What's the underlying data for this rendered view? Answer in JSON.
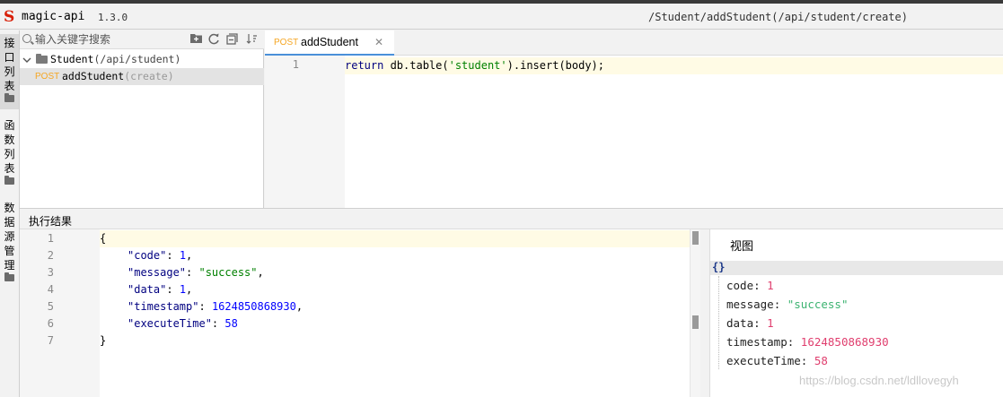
{
  "app": {
    "title": "magic-api",
    "version": "1.3.0",
    "current_path": "/Student/addStudent(/api/student/create)"
  },
  "left_tabs": [
    {
      "label": "接\n口\n列\n表"
    },
    {
      "label": "函\n数\n列\n表"
    },
    {
      "label": "数\n据\n源\n管\n理"
    }
  ],
  "tree": {
    "search_placeholder": "输入关键字搜索",
    "toolbar_icons": [
      "folder-add-icon",
      "refresh-icon",
      "collapse-icon",
      "sort-icon"
    ],
    "group": {
      "name": "Student",
      "path": "(/api/student)"
    },
    "api": {
      "method": "POST",
      "name": "addStudent",
      "path": "(create)"
    }
  },
  "editor": {
    "tab": {
      "method": "POST",
      "name": "addStudent"
    },
    "line_number": "1",
    "code": {
      "keyword": "return",
      "pre": " db.table(",
      "string": "'student'",
      "post": ").insert(body);"
    }
  },
  "result": {
    "title": "执行结果",
    "line_numbers": [
      "1",
      "2",
      "3",
      "4",
      "5",
      "6",
      "7"
    ],
    "json": {
      "open": "{",
      "code_key": "\"code\"",
      "code_val": "1",
      "message_key": "\"message\"",
      "message_val": "\"success\"",
      "data_key": "\"data\"",
      "data_val": "1",
      "timestamp_key": "\"timestamp\"",
      "timestamp_val": "1624850868930",
      "executeTime_key": "\"executeTime\"",
      "executeTime_val": "58",
      "close": "}"
    }
  },
  "view": {
    "title": "视图",
    "root": "{}",
    "rows": [
      {
        "key": "code",
        "value": "1"
      },
      {
        "key": "message",
        "value": "\"success\""
      },
      {
        "key": "data",
        "value": "1"
      },
      {
        "key": "timestamp",
        "value": "1624850868930"
      },
      {
        "key": "executeTime",
        "value": "58"
      }
    ]
  },
  "watermark": "https://blog.csdn.net/ldllovegyh",
  "colors": {
    "accent": "#4a90d9",
    "post": "#f5a623",
    "logo": "#d81e06",
    "string": "#008000",
    "number": "#0000ff"
  }
}
